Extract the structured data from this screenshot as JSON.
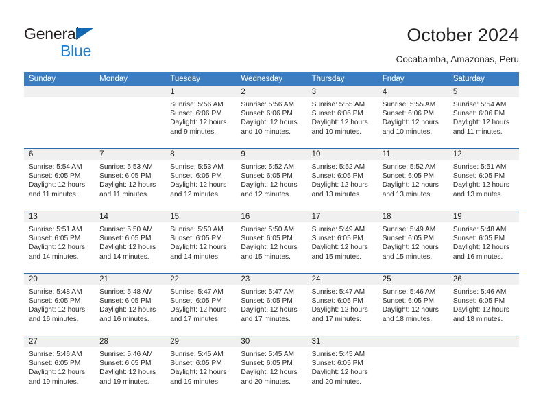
{
  "brand": {
    "line1": "General",
    "line2": "Blue",
    "accent_dark": "#231f20",
    "accent_blue": "#1b7fd4",
    "triangle_color": "#1268b3"
  },
  "header": {
    "title": "October 2024",
    "subtitle": "Cocabamba, Amazonas, Peru"
  },
  "calendar": {
    "header_bg": "#3b7dc0",
    "week_divider": "#2c6cab",
    "daynum_bg": "#f0f0f0",
    "weekdays": [
      "Sunday",
      "Monday",
      "Tuesday",
      "Wednesday",
      "Thursday",
      "Friday",
      "Saturday"
    ],
    "weeks": [
      [
        {
          "day": "",
          "info": ""
        },
        {
          "day": "",
          "info": ""
        },
        {
          "day": "1",
          "info": "Sunrise: 5:56 AM\nSunset: 6:06 PM\nDaylight: 12 hours\nand 9 minutes."
        },
        {
          "day": "2",
          "info": "Sunrise: 5:56 AM\nSunset: 6:06 PM\nDaylight: 12 hours\nand 10 minutes."
        },
        {
          "day": "3",
          "info": "Sunrise: 5:55 AM\nSunset: 6:06 PM\nDaylight: 12 hours\nand 10 minutes."
        },
        {
          "day": "4",
          "info": "Sunrise: 5:55 AM\nSunset: 6:06 PM\nDaylight: 12 hours\nand 10 minutes."
        },
        {
          "day": "5",
          "info": "Sunrise: 5:54 AM\nSunset: 6:06 PM\nDaylight: 12 hours\nand 11 minutes."
        }
      ],
      [
        {
          "day": "6",
          "info": "Sunrise: 5:54 AM\nSunset: 6:05 PM\nDaylight: 12 hours\nand 11 minutes."
        },
        {
          "day": "7",
          "info": "Sunrise: 5:53 AM\nSunset: 6:05 PM\nDaylight: 12 hours\nand 11 minutes."
        },
        {
          "day": "8",
          "info": "Sunrise: 5:53 AM\nSunset: 6:05 PM\nDaylight: 12 hours\nand 12 minutes."
        },
        {
          "day": "9",
          "info": "Sunrise: 5:52 AM\nSunset: 6:05 PM\nDaylight: 12 hours\nand 12 minutes."
        },
        {
          "day": "10",
          "info": "Sunrise: 5:52 AM\nSunset: 6:05 PM\nDaylight: 12 hours\nand 13 minutes."
        },
        {
          "day": "11",
          "info": "Sunrise: 5:52 AM\nSunset: 6:05 PM\nDaylight: 12 hours\nand 13 minutes."
        },
        {
          "day": "12",
          "info": "Sunrise: 5:51 AM\nSunset: 6:05 PM\nDaylight: 12 hours\nand 13 minutes."
        }
      ],
      [
        {
          "day": "13",
          "info": "Sunrise: 5:51 AM\nSunset: 6:05 PM\nDaylight: 12 hours\nand 14 minutes."
        },
        {
          "day": "14",
          "info": "Sunrise: 5:50 AM\nSunset: 6:05 PM\nDaylight: 12 hours\nand 14 minutes."
        },
        {
          "day": "15",
          "info": "Sunrise: 5:50 AM\nSunset: 6:05 PM\nDaylight: 12 hours\nand 14 minutes."
        },
        {
          "day": "16",
          "info": "Sunrise: 5:50 AM\nSunset: 6:05 PM\nDaylight: 12 hours\nand 15 minutes."
        },
        {
          "day": "17",
          "info": "Sunrise: 5:49 AM\nSunset: 6:05 PM\nDaylight: 12 hours\nand 15 minutes."
        },
        {
          "day": "18",
          "info": "Sunrise: 5:49 AM\nSunset: 6:05 PM\nDaylight: 12 hours\nand 15 minutes."
        },
        {
          "day": "19",
          "info": "Sunrise: 5:48 AM\nSunset: 6:05 PM\nDaylight: 12 hours\nand 16 minutes."
        }
      ],
      [
        {
          "day": "20",
          "info": "Sunrise: 5:48 AM\nSunset: 6:05 PM\nDaylight: 12 hours\nand 16 minutes."
        },
        {
          "day": "21",
          "info": "Sunrise: 5:48 AM\nSunset: 6:05 PM\nDaylight: 12 hours\nand 16 minutes."
        },
        {
          "day": "22",
          "info": "Sunrise: 5:47 AM\nSunset: 6:05 PM\nDaylight: 12 hours\nand 17 minutes."
        },
        {
          "day": "23",
          "info": "Sunrise: 5:47 AM\nSunset: 6:05 PM\nDaylight: 12 hours\nand 17 minutes."
        },
        {
          "day": "24",
          "info": "Sunrise: 5:47 AM\nSunset: 6:05 PM\nDaylight: 12 hours\nand 17 minutes."
        },
        {
          "day": "25",
          "info": "Sunrise: 5:46 AM\nSunset: 6:05 PM\nDaylight: 12 hours\nand 18 minutes."
        },
        {
          "day": "26",
          "info": "Sunrise: 5:46 AM\nSunset: 6:05 PM\nDaylight: 12 hours\nand 18 minutes."
        }
      ],
      [
        {
          "day": "27",
          "info": "Sunrise: 5:46 AM\nSunset: 6:05 PM\nDaylight: 12 hours\nand 19 minutes."
        },
        {
          "day": "28",
          "info": "Sunrise: 5:46 AM\nSunset: 6:05 PM\nDaylight: 12 hours\nand 19 minutes."
        },
        {
          "day": "29",
          "info": "Sunrise: 5:45 AM\nSunset: 6:05 PM\nDaylight: 12 hours\nand 19 minutes."
        },
        {
          "day": "30",
          "info": "Sunrise: 5:45 AM\nSunset: 6:05 PM\nDaylight: 12 hours\nand 20 minutes."
        },
        {
          "day": "31",
          "info": "Sunrise: 5:45 AM\nSunset: 6:05 PM\nDaylight: 12 hours\nand 20 minutes."
        },
        {
          "day": "",
          "info": ""
        },
        {
          "day": "",
          "info": ""
        }
      ]
    ]
  }
}
